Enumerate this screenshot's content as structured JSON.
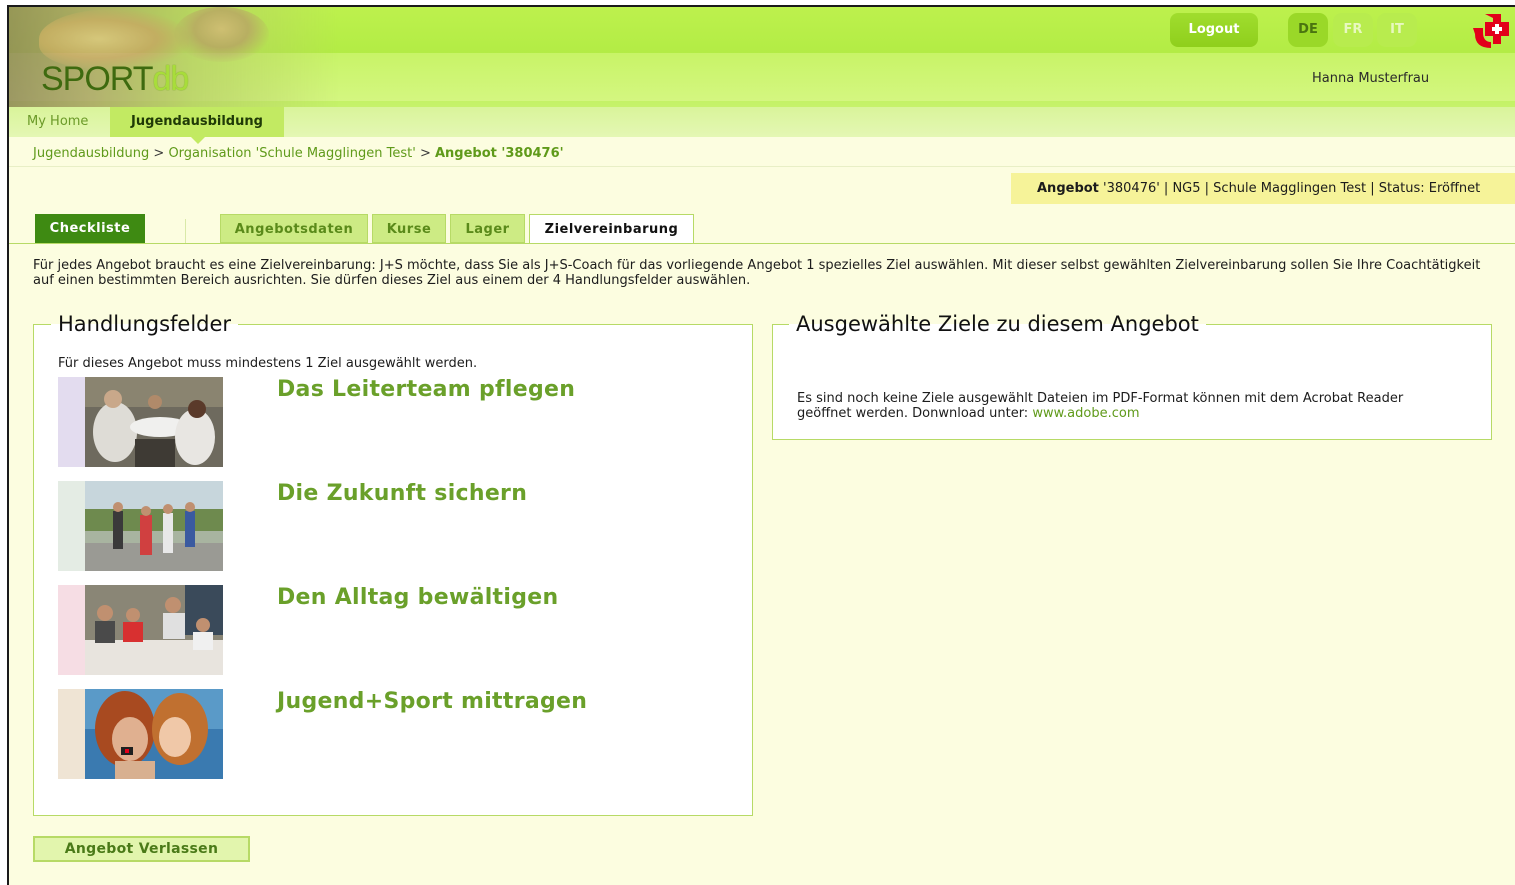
{
  "header": {
    "logo_main": "SPORT",
    "logo_sub": "db",
    "logout_label": "Logout",
    "languages": [
      {
        "code": "DE",
        "active": true
      },
      {
        "code": "FR",
        "active": false
      },
      {
        "code": "IT",
        "active": false
      }
    ],
    "user_name": "Hanna Musterfrau",
    "brand_icon": "jugend-sport-logo-icon"
  },
  "nav": {
    "home": "My Home",
    "active": "Jugendausbildung"
  },
  "breadcrumb": {
    "item1": "Jugendausbildung",
    "item2": "Organisation 'Schule Magglingen Test'",
    "current": "Angebot '380476'",
    "separator": ">"
  },
  "status": {
    "label": "Angebot",
    "text": "'380476' | NG5 | Schule Magglingen Test | Status: Eröffnet"
  },
  "tabs": {
    "checklist": "Checkliste",
    "offer_data": "Angebotsdaten",
    "courses": "Kurse",
    "camps": "Lager",
    "goal_agreement": "Zielvereinbarung"
  },
  "intro": "Für jedes Angebot braucht es eine Zielvereinbarung: J+S möchte, dass Sie als J+S-Coach für das vorliegende Angebot 1 spezielles Ziel auswählen. Mit dieser selbst gewählten Zielvereinbarung sollen Sie Ihre Coachtätigkeit auf einen bestimmten Bereich ausrichten. Sie dürfen dieses Ziel aus einem der 4 Handlungsfelder auswählen.",
  "fields_panel": {
    "title": "Handlungsfelder",
    "hint": "Für dieses Angebot muss mindestens 1 Ziel ausgewählt werden.",
    "items": [
      {
        "title": "Das Leiterteam pflegen"
      },
      {
        "title": "Die Zukunft sichern"
      },
      {
        "title": "Den Alltag bewältigen"
      },
      {
        "title": "Jugend+Sport mittragen"
      }
    ]
  },
  "selected_panel": {
    "title": "Ausgewählte Ziele zu diesem Angebot",
    "text": "Es sind noch keine Ziele ausgewählt Dateien im PDF-Format können mit dem Acrobat Reader geöffnet werden. Donwnload unter:",
    "link": "www.adobe.com"
  },
  "leave_button": "Angebot Verlassen",
  "colors": {
    "brand_green": "#3e8a12",
    "link_green": "#5f9a1a",
    "header_green": "#b3ec45",
    "swiss_red": "#e2001a"
  }
}
